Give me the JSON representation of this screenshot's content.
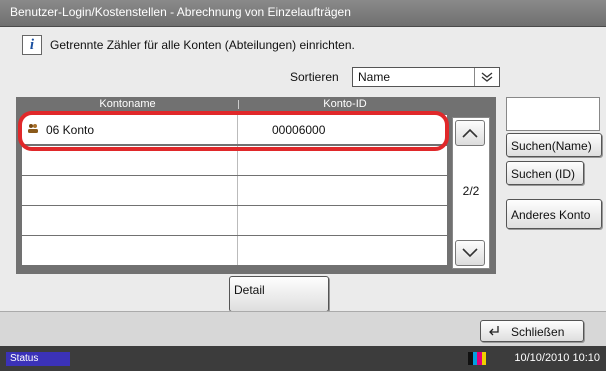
{
  "window": {
    "title": "Benutzer-Login/Kostenstellen - Abrechnung von Einzelaufträgen"
  },
  "info": {
    "icon": "info-icon",
    "text": "Getrennte Zähler für alle Konten (Abteilungen) einrichten."
  },
  "sort": {
    "label": "Sortieren",
    "selected": "Name"
  },
  "table": {
    "headers": [
      "Kontoname",
      "Konto-ID"
    ],
    "rows": [
      {
        "name": "06 Konto",
        "id": "00006000"
      },
      {
        "name": "",
        "id": ""
      },
      {
        "name": "",
        "id": ""
      },
      {
        "name": "",
        "id": ""
      },
      {
        "name": "",
        "id": ""
      }
    ],
    "page": "2/2"
  },
  "buttons": {
    "search_name": "Suchen(Name)",
    "search_id": "Suchen (ID)",
    "other_account": "Anderes Konto",
    "detail": "Detail",
    "close": "Schließen"
  },
  "status": {
    "label": "Status",
    "datetime": "10/10/2010  10:10"
  },
  "colors": {
    "highlight": "#e0282a",
    "status_button": "#3b32b8"
  }
}
